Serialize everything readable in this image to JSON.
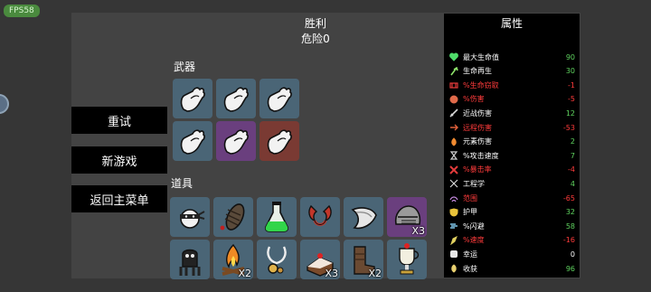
{
  "fps": "FPS58",
  "result": {
    "title": "胜利",
    "danger": "危险0"
  },
  "menu": {
    "retry": "重试",
    "new_game": "新游戏",
    "main_menu": "返回主菜单"
  },
  "sections": {
    "weapons": "武器",
    "items": "道具"
  },
  "weapons": [
    {
      "icon": "hand-icon",
      "tier": "blue"
    },
    {
      "icon": "hand-icon",
      "tier": "blue"
    },
    {
      "icon": "hand-icon",
      "tier": "blue"
    },
    {
      "icon": "hand-icon",
      "tier": "blue"
    },
    {
      "icon": "hand-icon",
      "tier": "purple"
    },
    {
      "icon": "hand-icon",
      "tier": "red"
    }
  ],
  "items": {
    "row1": [
      {
        "icon": "ninja-head-icon",
        "count": ""
      },
      {
        "icon": "larva-icon",
        "count": ""
      },
      {
        "icon": "potion-flask-icon",
        "count": ""
      },
      {
        "icon": "red-claws-icon",
        "count": ""
      },
      {
        "icon": "blade-icon",
        "count": ""
      },
      {
        "icon": "knight-helmet-icon",
        "count": "X3"
      }
    ],
    "row2": [
      {
        "icon": "diving-suit-icon",
        "count": ""
      },
      {
        "icon": "campfire-icon",
        "count": "X2"
      },
      {
        "icon": "pendant-icon",
        "count": ""
      },
      {
        "icon": "cake-icon",
        "count": "X3"
      },
      {
        "icon": "leather-boots-icon",
        "count": "X2"
      },
      {
        "icon": "trophy-cup-icon",
        "count": ""
      }
    ]
  },
  "stats": {
    "title": "属性",
    "rows": [
      {
        "icon": "heart-icon",
        "name": "最大生命值",
        "value": "90",
        "tone": "pos",
        "color": "#4fdc6a"
      },
      {
        "icon": "regen-icon",
        "name": "生命再生",
        "value": "30",
        "tone": "pos",
        "color": "#8ee36b"
      },
      {
        "icon": "lifesteal-icon",
        "name": "%生命窃取",
        "value": "-1",
        "tone": "neg",
        "color": "#e33a3a"
      },
      {
        "icon": "damage-icon",
        "name": "%伤害",
        "value": "-5",
        "tone": "neg",
        "color": "#e06a4a"
      },
      {
        "icon": "melee-icon",
        "name": "近战伤害",
        "value": "12",
        "tone": "pos",
        "color": "#d9d9d9"
      },
      {
        "icon": "ranged-icon",
        "name": "远程伤害",
        "value": "-53",
        "tone": "neg",
        "color": "#e0603a"
      },
      {
        "icon": "elemental-icon",
        "name": "元素伤害",
        "value": "2",
        "tone": "pos",
        "color": "#f08a30"
      },
      {
        "icon": "attack-speed-icon",
        "name": "%攻击速度",
        "value": "7",
        "tone": "pos",
        "color": "#cfcfcf"
      },
      {
        "icon": "crit-icon",
        "name": "%暴击率",
        "value": "-4",
        "tone": "neg",
        "color": "#e23b3b"
      },
      {
        "icon": "engineering-icon",
        "name": "工程学",
        "value": "4",
        "tone": "pos",
        "color": "#d8d8d8"
      },
      {
        "icon": "range-icon",
        "name": "范围",
        "value": "-65",
        "tone": "neg",
        "color": "#c58ae0"
      },
      {
        "icon": "armor-icon",
        "name": "护甲",
        "value": "32",
        "tone": "pos",
        "color": "#e8c23a"
      },
      {
        "icon": "dodge-icon",
        "name": "%闪避",
        "value": "58",
        "tone": "pos",
        "color": "#7fc6e8"
      },
      {
        "icon": "speed-icon",
        "name": "%速度",
        "value": "-16",
        "tone": "neg",
        "color": "#e0d060"
      },
      {
        "icon": "luck-icon",
        "name": "幸运",
        "value": "0",
        "tone": "zero",
        "color": "#e8e8e8"
      },
      {
        "icon": "harvest-icon",
        "name": "收获",
        "value": "96",
        "tone": "pos",
        "color": "#e8d070"
      }
    ]
  }
}
